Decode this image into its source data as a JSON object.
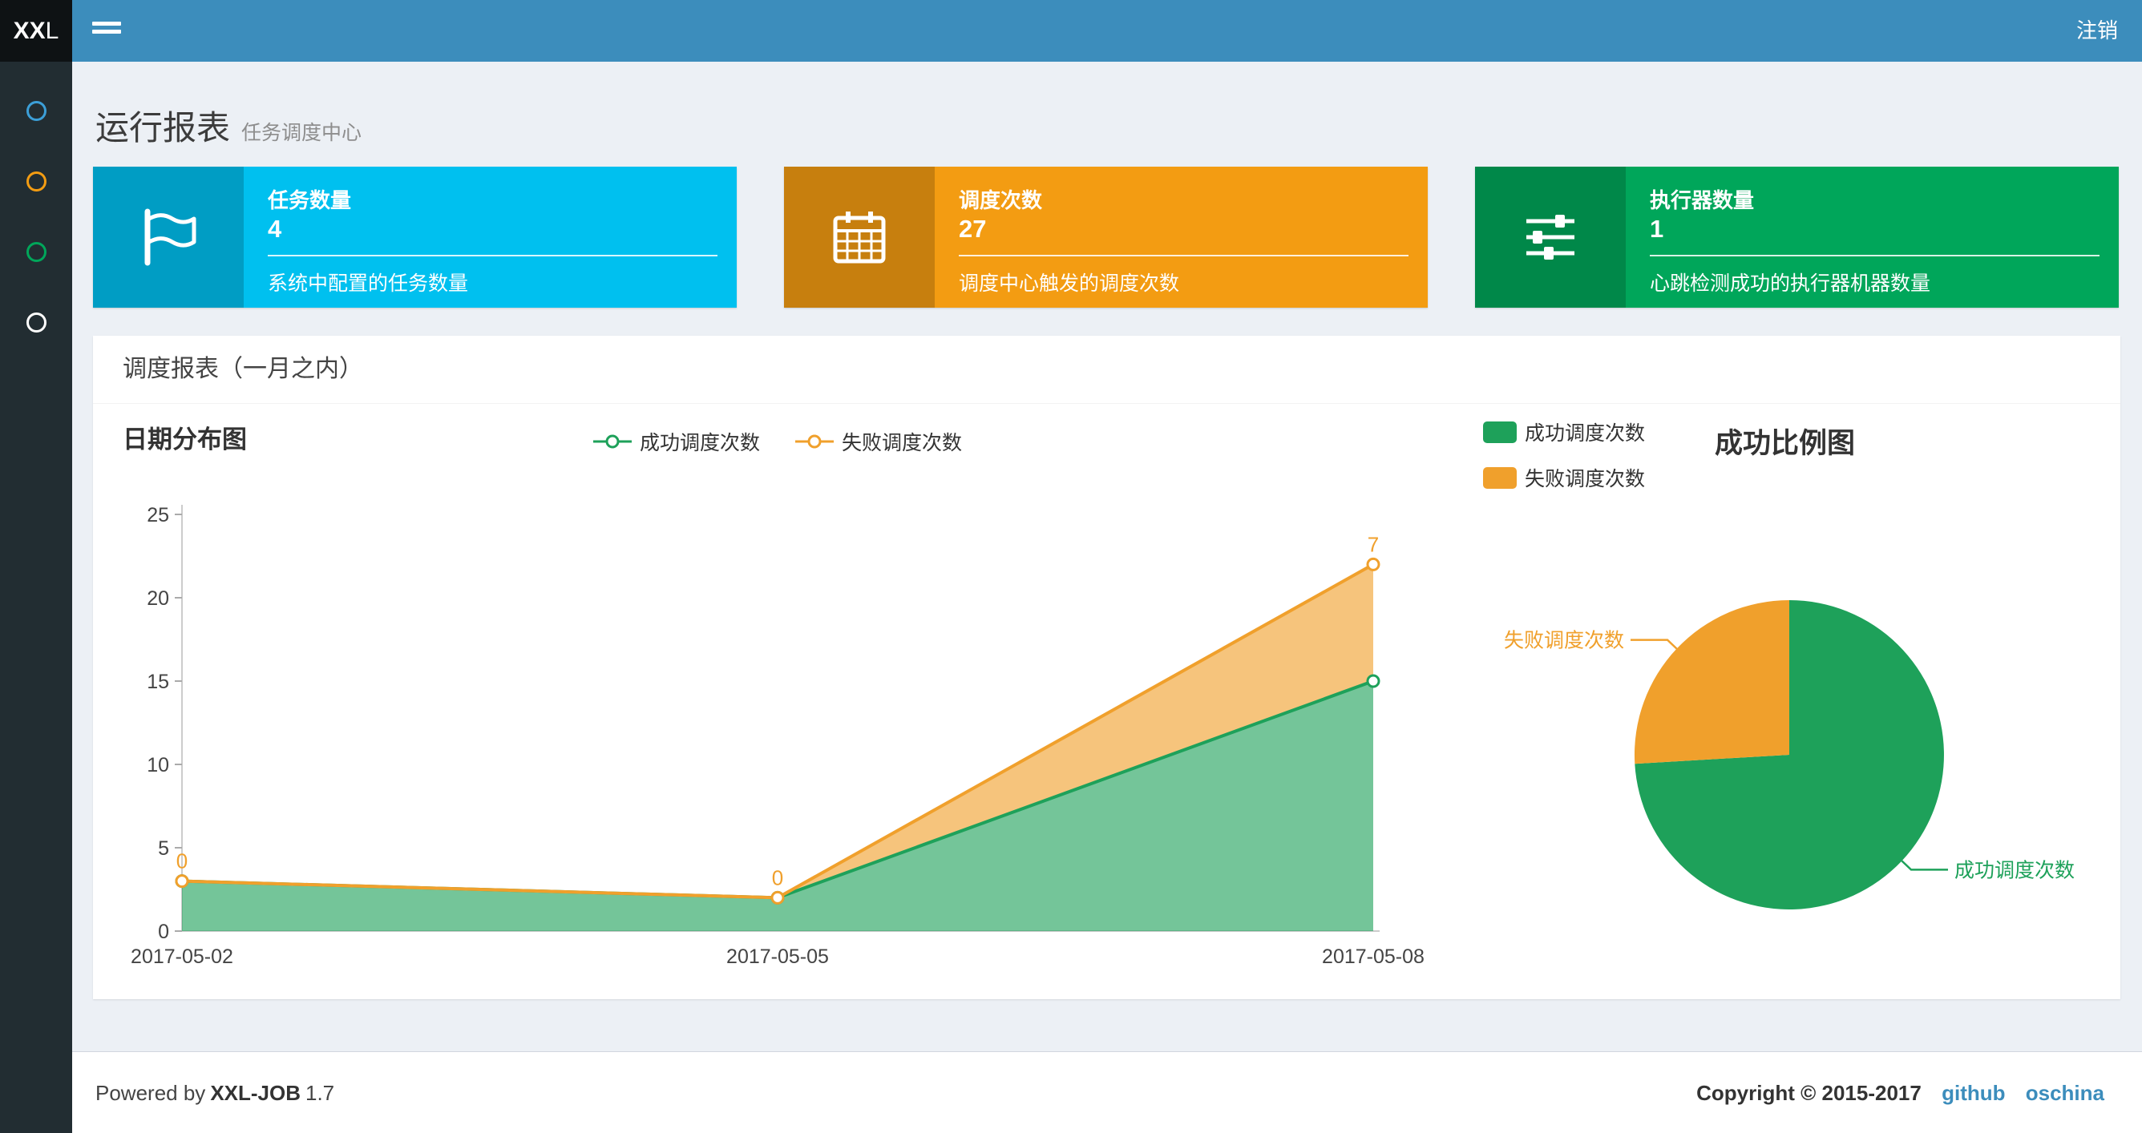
{
  "colors": {
    "green": "#1ea15a",
    "orange": "#f0a02c",
    "navbar_blue": "#3c8dbc",
    "aqua": "#00c0ef",
    "yellow": "#f39c12",
    "box_green": "#00a65a"
  },
  "navbar": {
    "logo_bold": "XX",
    "logo_light": "L",
    "logout_label": "注销"
  },
  "sidebar": {
    "items": [
      {
        "icon": "circle-icon",
        "color": "#3c9fd8"
      },
      {
        "icon": "circle-icon",
        "color": "#f39c12"
      },
      {
        "icon": "circle-icon",
        "color": "#00a65a"
      },
      {
        "icon": "circle-icon",
        "color": "#ffffff"
      }
    ]
  },
  "header": {
    "title": "运行报表",
    "subtitle": "任务调度中心"
  },
  "info_boxes": [
    {
      "icon": "flag-icon",
      "title": "任务数量",
      "value": "4",
      "desc": "系统中配置的任务数量",
      "bg": "#00c0ef"
    },
    {
      "icon": "calendar-icon",
      "title": "调度次数",
      "value": "27",
      "desc": "调度中心触发的调度次数",
      "bg": "#f39c12"
    },
    {
      "icon": "sliders-icon",
      "title": "执行器数量",
      "value": "1",
      "desc": "心跳检测成功的执行器机器数量",
      "bg": "#00a65a"
    }
  ],
  "panel": {
    "title": "调度报表（一月之内）"
  },
  "chart_data": [
    {
      "type": "area",
      "title": "日期分布图",
      "x": [
        "2017-05-02",
        "2017-05-05",
        "2017-05-08"
      ],
      "series": [
        {
          "name": "成功调度次数",
          "values": [
            3,
            2,
            15
          ],
          "color_key": "green",
          "show_labels": false
        },
        {
          "name": "失败调度次数",
          "values": [
            0,
            0,
            7
          ],
          "color_key": "orange",
          "show_labels": true
        }
      ],
      "stacked": true,
      "ylim": [
        0,
        25
      ],
      "yticks": [
        0,
        5,
        10,
        15,
        20,
        25
      ],
      "grid": false,
      "legend_position": "top-center"
    },
    {
      "type": "pie",
      "title": "成功比例图",
      "slices": [
        {
          "name": "成功调度次数",
          "value": 20,
          "color_key": "green"
        },
        {
          "name": "失败调度次数",
          "value": 7,
          "color_key": "orange"
        }
      ],
      "legend_position": "top-left"
    }
  ],
  "footer": {
    "powered_by": "Powered by",
    "app": "XXL-JOB",
    "version": "1.7",
    "copyright": "Copyright © 2015-2017",
    "links": [
      {
        "label": "github"
      },
      {
        "label": "oschina"
      }
    ]
  }
}
